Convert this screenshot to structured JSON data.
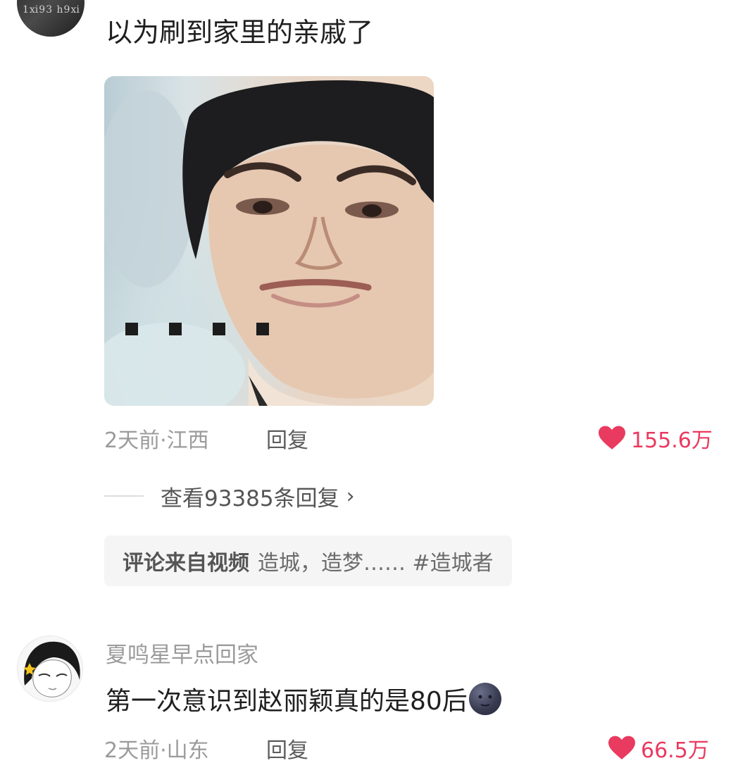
{
  "comments": [
    {
      "avatar_text": "1ⅺ93 h9ⅺ",
      "text": "以为刷到家里的亲戚了",
      "time": "2天前",
      "location": "江西",
      "reply_label": "回复",
      "likes": "155.6万"
    },
    {
      "username": "夏鸣星早点回家",
      "text": "第一次意识到赵丽颖真的是80后",
      "time": "2天前",
      "location": "山东",
      "reply_label": "回复",
      "likes": "66.5万",
      "emoji": "new-moon-face"
    }
  ],
  "view_replies": {
    "label": "查看93385条回复",
    "chevron": "›"
  },
  "source": {
    "label": "评论来自视频",
    "title": "造城，造梦…… #造城者"
  },
  "colors": {
    "like": "#e93a5f",
    "meta": "#9b9b9b",
    "source_bg": "#f5f5f5"
  },
  "icons": [
    "heart-icon",
    "chevron-right-icon",
    "avatar",
    "moon-face-emoji"
  ]
}
